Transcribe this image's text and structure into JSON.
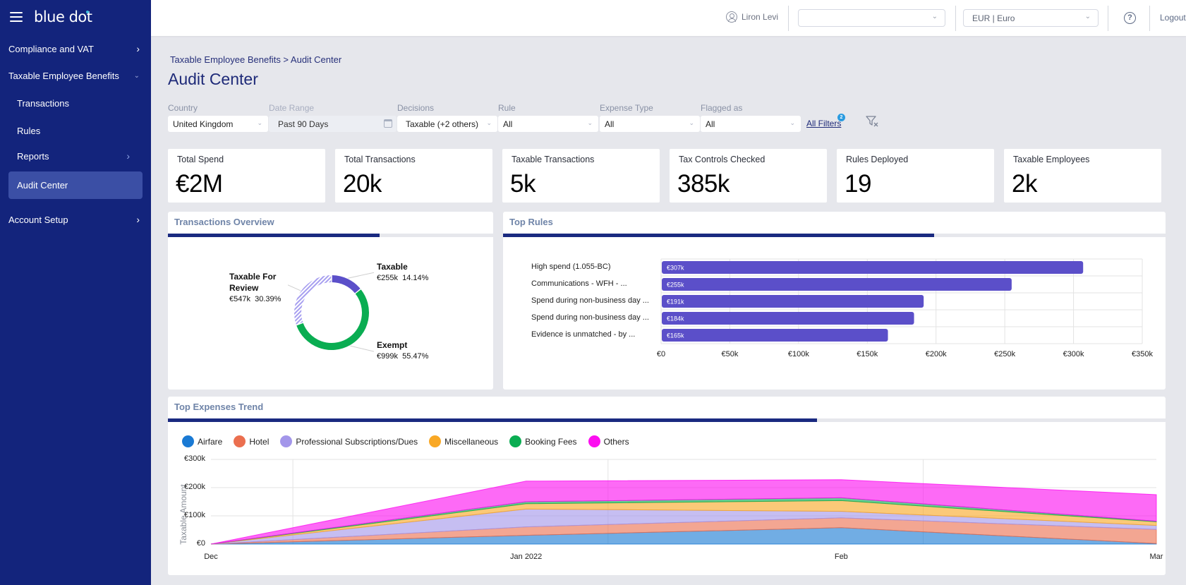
{
  "app": {
    "logo_text": "blue dot",
    "menu_icon": "hamburger-icon"
  },
  "sidebar": {
    "items": [
      {
        "label": "Compliance and VAT",
        "icon": "chevron-right-icon"
      },
      {
        "label": "Taxable Employee Benefits",
        "icon": "chevron-down-icon"
      },
      {
        "label": "Transactions"
      },
      {
        "label": "Rules"
      },
      {
        "label": "Reports",
        "icon": "chevron-right-icon"
      },
      {
        "label": "Audit Center",
        "active": true
      },
      {
        "label": "Account Setup",
        "icon": "chevron-right-icon"
      }
    ]
  },
  "header": {
    "user_name": "Liron Levi",
    "entity_select_value": "",
    "currency_select_value": "EUR | Euro",
    "help_label": "?",
    "logout_label": "Logout"
  },
  "breadcrumb": {
    "parent": "Taxable Employee Benefits",
    "separator": " > ",
    "current": "Audit Center"
  },
  "page_title": "Audit Center",
  "filters": {
    "country": {
      "label": "Country",
      "value": "United Kingdom"
    },
    "date_range": {
      "label": "Date Range",
      "value": "Past 90 Days"
    },
    "decisions": {
      "label": "Decisions",
      "value": "Taxable (+2 others)"
    },
    "rule": {
      "label": "Rule",
      "value": "All"
    },
    "expense_type": {
      "label": "Expense Type",
      "value": "All"
    },
    "flagged_as": {
      "label": "Flagged as",
      "value": "All"
    },
    "all_filters_label": "All Filters",
    "all_filters_count": "2"
  },
  "kpis": [
    {
      "label": "Total Spend",
      "value": "€2M"
    },
    {
      "label": "Total Transactions",
      "value": "20k"
    },
    {
      "label": "Taxable Transactions",
      "value": "5k"
    },
    {
      "label": "Tax Controls Checked",
      "value": "385k"
    },
    {
      "label": "Rules Deployed",
      "value": "19"
    },
    {
      "label": "Taxable Employees",
      "value": "2k"
    }
  ],
  "panels": {
    "transactions_overview": {
      "title": "Transactions Overview"
    },
    "top_rules": {
      "title": "Top Rules"
    },
    "top_expenses_trend": {
      "title": "Top Expenses Trend"
    }
  },
  "chart_data": [
    {
      "type": "pie",
      "title": "Transactions Overview",
      "donut": true,
      "slices": [
        {
          "name": "Taxable",
          "amount_label": "€255k",
          "value": 255,
          "percent": 14.14,
          "percent_label": "14.14%",
          "color": "#5b4fc9"
        },
        {
          "name": "Exempt",
          "amount_label": "€999k",
          "value": 999,
          "percent": 55.47,
          "percent_label": "55.47%",
          "color": "#0aad52"
        },
        {
          "name": "Taxable For Review",
          "amount_label": "€547k",
          "value": 547,
          "percent": 30.39,
          "percent_label": "30.39%",
          "color": "#a79ff0",
          "pattern": "hatched"
        }
      ]
    },
    {
      "type": "bar",
      "orientation": "horizontal",
      "title": "Top Rules",
      "categories": [
        "High spend (1.055-BC)",
        "Communications - WFH - ...",
        "Spend during non-business day ...",
        "Spend during non-business day ...",
        "Evidence is unmatched - by ..."
      ],
      "values": [
        307,
        255,
        191,
        184,
        165
      ],
      "value_labels": [
        "€307k",
        "€255k",
        "€191k",
        "€184k",
        "€165k"
      ],
      "units": "k EUR",
      "xlim": [
        0,
        350
      ],
      "xticks": [
        0,
        50,
        100,
        150,
        200,
        250,
        300,
        350
      ],
      "xtick_labels": [
        "€0",
        "€50k",
        "€100k",
        "€150k",
        "€200k",
        "€250k",
        "€300k",
        "€350k"
      ],
      "bar_color": "#5b4fc9",
      "grid": true
    },
    {
      "type": "area",
      "stacked": true,
      "title": "Top Expenses Trend",
      "x": [
        "Dec",
        "Jan 2022",
        "Feb",
        "Mar"
      ],
      "xtick_labels": [
        "Dec",
        "Jan 2022",
        "Feb",
        "Mar"
      ],
      "ylabel": "Taxable Amount",
      "ylim": [
        0,
        300
      ],
      "yticks": [
        0,
        100,
        200,
        300
      ],
      "ytick_labels": [
        "€0",
        "€100k",
        "€200k",
        "€300k"
      ],
      "units": "k EUR",
      "legend_position": "top-left",
      "series": [
        {
          "name": "Airfare",
          "color": "#1a7ad4",
          "values": [
            0,
            31,
            58,
            2
          ]
        },
        {
          "name": "Hotel",
          "color": "#eb6f4f",
          "values": [
            0,
            30,
            35,
            50
          ]
        },
        {
          "name": "Professional Subscriptions/Dues",
          "color": "#a396ea",
          "values": [
            0,
            63,
            23,
            14
          ]
        },
        {
          "name": "Miscellaneous",
          "color": "#f9a825",
          "values": [
            0,
            19,
            38,
            13
          ]
        },
        {
          "name": "Booking Fees",
          "color": "#0aad52",
          "values": [
            0,
            7,
            10,
            2
          ]
        },
        {
          "name": "Others",
          "color": "#fc0ef0",
          "values": [
            0,
            73,
            64,
            94
          ]
        }
      ]
    }
  ]
}
